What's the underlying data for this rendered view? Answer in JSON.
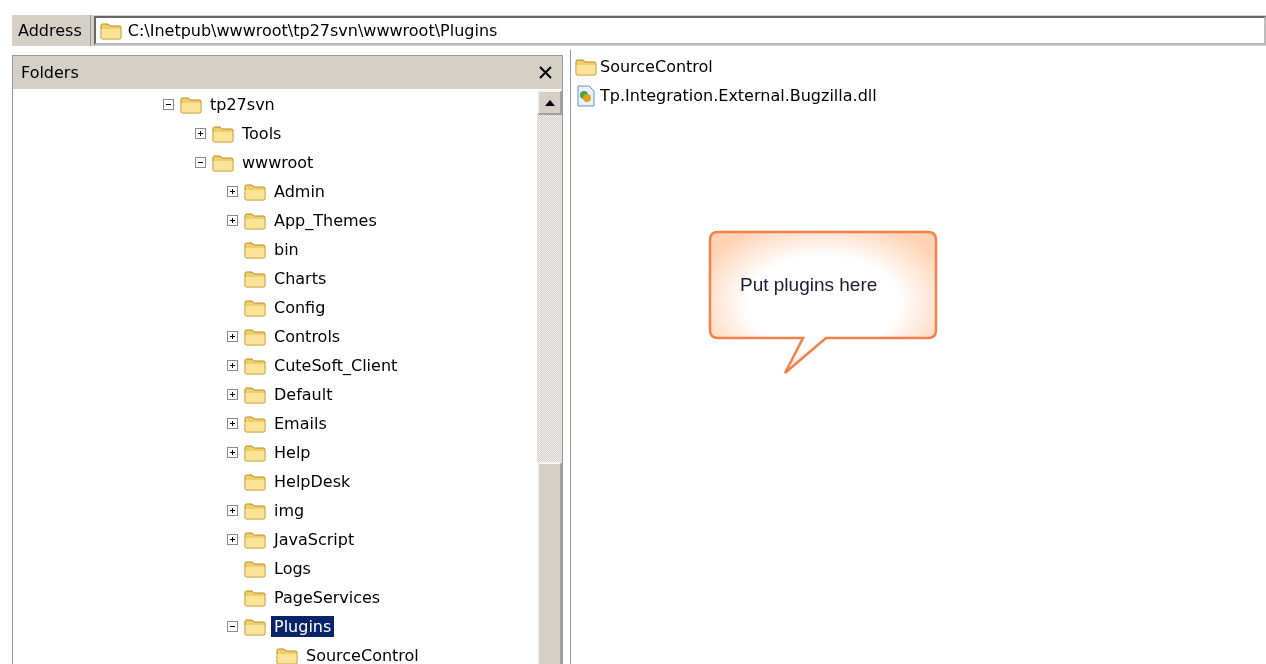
{
  "address_bar": {
    "label": "Address",
    "path": "C:\\Inetpub\\wwwroot\\tp27svn\\wwwroot\\Plugins"
  },
  "folders_pane": {
    "title": "Folders",
    "tree": [
      {
        "label": "tp27svn",
        "kind": "expandable",
        "expanded": true,
        "selected": false,
        "children": [
          {
            "label": "Tools",
            "kind": "expandable",
            "expanded": false,
            "selected": false
          },
          {
            "label": "wwwroot",
            "kind": "expandable",
            "expanded": true,
            "selected": false,
            "children": [
              {
                "label": "Admin",
                "kind": "expandable",
                "expanded": false,
                "selected": false
              },
              {
                "label": "App_Themes",
                "kind": "expandable",
                "expanded": false,
                "selected": false
              },
              {
                "label": "bin",
                "kind": "leaf",
                "selected": false
              },
              {
                "label": "Charts",
                "kind": "leaf",
                "selected": false
              },
              {
                "label": "Config",
                "kind": "leaf",
                "selected": false
              },
              {
                "label": "Controls",
                "kind": "expandable",
                "expanded": false,
                "selected": false
              },
              {
                "label": "CuteSoft_Client",
                "kind": "expandable",
                "expanded": false,
                "selected": false
              },
              {
                "label": "Default",
                "kind": "expandable",
                "expanded": false,
                "selected": false
              },
              {
                "label": "Emails",
                "kind": "expandable",
                "expanded": false,
                "selected": false
              },
              {
                "label": "Help",
                "kind": "expandable",
                "expanded": false,
                "selected": false
              },
              {
                "label": "HelpDesk",
                "kind": "leaf",
                "selected": false
              },
              {
                "label": "img",
                "kind": "expandable",
                "expanded": false,
                "selected": false
              },
              {
                "label": "JavaScript",
                "kind": "expandable",
                "expanded": false,
                "selected": false
              },
              {
                "label": "Logs",
                "kind": "leaf",
                "selected": false
              },
              {
                "label": "PageServices",
                "kind": "leaf",
                "selected": false
              },
              {
                "label": "Plugins",
                "kind": "expandable",
                "expanded": true,
                "selected": true,
                "children": [
                  {
                    "label": "SourceControl",
                    "kind": "leaf",
                    "selected": false
                  }
                ]
              }
            ]
          }
        ]
      }
    ]
  },
  "files": [
    {
      "name": "SourceControl",
      "kind": "folder"
    },
    {
      "name": "Tp.Integration.External.Bugzilla.dll",
      "kind": "dll"
    }
  ],
  "callout": {
    "text": "Put plugins here"
  }
}
